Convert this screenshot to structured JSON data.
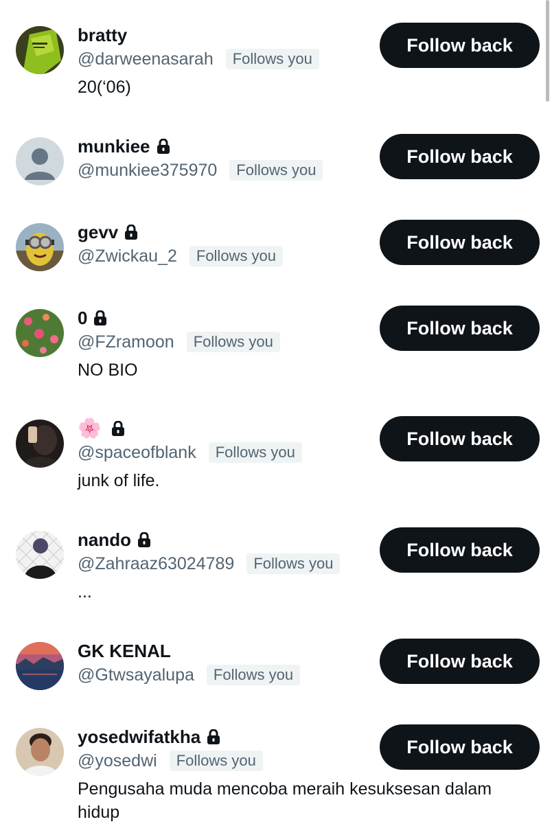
{
  "followers": [
    {
      "name": "bratty",
      "locked": false,
      "handle": "@darweenasarah",
      "badge": "Follows you",
      "bio": "20(‘06)",
      "button": "Follow back",
      "avatar": "green-photo-avatar"
    },
    {
      "name": "munkiee",
      "locked": true,
      "handle": "@munkiee375970",
      "badge": "Follows you",
      "bio": "",
      "button": "Follow back",
      "avatar": "default-person-avatar"
    },
    {
      "name": "gevv",
      "locked": true,
      "handle": "@Zwickau_2",
      "badge": "Follows you",
      "bio": "",
      "button": "Follow back",
      "avatar": "minion-photo-avatar"
    },
    {
      "name": "0",
      "locked": true,
      "handle": "@FZramoon",
      "badge": "Follows you",
      "bio": "NO BIO",
      "button": "Follow back",
      "avatar": "flowers-photo-avatar"
    },
    {
      "name": "🌸",
      "locked": true,
      "handle": "@spaceofblank",
      "badge": "Follows you",
      "bio": "junk of life.",
      "button": "Follow back",
      "avatar": "selfie-photo-avatar"
    },
    {
      "name": "nando",
      "locked": true,
      "handle": "@Zahraaz63024789",
      "badge": "Follows you",
      "bio": "...",
      "button": "Follow back",
      "avatar": "anime-photo-avatar"
    },
    {
      "name": "GK KENAL",
      "locked": false,
      "handle": "@Gtwsayalupa",
      "badge": "Follows you",
      "bio": "",
      "button": "Follow back",
      "avatar": "sunset-photo-avatar"
    },
    {
      "name": "yosedwifatkha",
      "locked": true,
      "handle": "@yosedwi",
      "badge": "Follows you",
      "bio": "Pengusaha muda mencoba meraih kesuksesan dalam hidup",
      "button": "Follow back",
      "avatar": "person-photo-avatar"
    }
  ]
}
